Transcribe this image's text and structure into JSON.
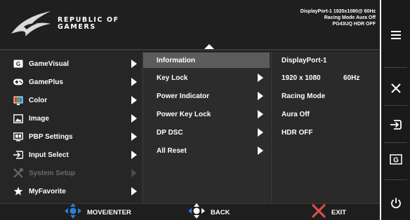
{
  "header": {
    "brand_line1": "REPUBLIC OF",
    "brand_line2": "GAMERS",
    "status_line1": "DisplayPort-1 1920x1080@ 60Hz",
    "status_line2": "Racing Mode Aura Off",
    "status_line3": "PG43UQ HDR OFF"
  },
  "main_menu": {
    "items": [
      {
        "label": "GameVisual",
        "icon": "gamevisual-icon",
        "enabled": true
      },
      {
        "label": "GamePlus",
        "icon": "gamepad-icon",
        "enabled": true
      },
      {
        "label": "Color",
        "icon": "color-icon",
        "enabled": true
      },
      {
        "label": "Image",
        "icon": "image-icon",
        "enabled": true
      },
      {
        "label": "PBP Settings",
        "icon": "pbp-icon",
        "enabled": true
      },
      {
        "label": "Input Select",
        "icon": "input-icon",
        "enabled": true
      },
      {
        "label": "System Setup",
        "icon": "tools-icon",
        "enabled": false
      },
      {
        "label": "MyFavorite",
        "icon": "star-icon",
        "enabled": true
      }
    ]
  },
  "submenu": {
    "items": [
      {
        "label": "Information",
        "selected": true,
        "has_arrow": false
      },
      {
        "label": "Key Lock",
        "selected": false,
        "has_arrow": true
      },
      {
        "label": "Power Indicator",
        "selected": false,
        "has_arrow": true
      },
      {
        "label": "Power Key Lock",
        "selected": false,
        "has_arrow": true
      },
      {
        "label": "DP DSC",
        "selected": false,
        "has_arrow": true
      },
      {
        "label": "All Reset",
        "selected": false,
        "has_arrow": true
      }
    ]
  },
  "info": {
    "input": "DisplayPort-1",
    "resolution": "1920 x 1080",
    "refresh": "60Hz",
    "mode": "Racing Mode",
    "aura": "Aura Off",
    "hdr": "HDR OFF"
  },
  "footer": {
    "move_enter": "MOVE/ENTER",
    "back": "BACK",
    "exit": "EXIT"
  },
  "side_panel": {
    "buttons": [
      "menu-icon",
      "close-icon",
      "input-icon",
      "gamevisual-icon",
      "power-icon"
    ]
  },
  "colors": {
    "accent_blue": "#2b7fd6",
    "exit_red": "#e04a4a",
    "selected_row": "#5c5c5c"
  }
}
